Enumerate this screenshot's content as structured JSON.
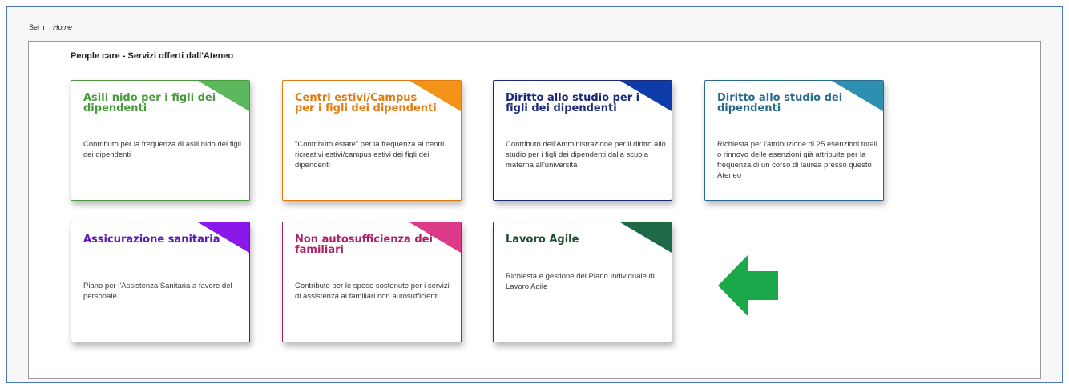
{
  "breadcrumb": {
    "prefix": "Sei in :",
    "current": "Home"
  },
  "panel": {
    "title": "People care - Servizi offerti dall'Ateneo"
  },
  "cards": [
    {
      "title": "Asili nido per i figli dei dipendenti",
      "description": "Contributo per la frequenza di asili nido dei figli dei dipendenti",
      "color": "#4a9a3d",
      "corner": "#5cb85c"
    },
    {
      "title": "Centri estivi/Campus per i figli dei dipendenti",
      "description": "\"Contributo estate\" per la frequenza ai centri ricreativi estivi/campus estivi dei figli dei dipendenti",
      "color": "#e07b12",
      "corner": "#f39419"
    },
    {
      "title": "Diritto allo studio per i figli dei dipendenti",
      "description": "Contributo dell'Amministrazione per il diritto allo studio per i figli dei dipendenti dalla scuola materna all'università",
      "color": "#1a2a78",
      "corner": "#0d3ca8"
    },
    {
      "title": "Diritto allo studio dei dipendenti",
      "description": "Richiesta per l'attribuzione di 25 esenzioni totali o rinnovo delle esenzioni già attribuite per la frequenza di un corso di laurea presso questo Ateneo",
      "color": "#2a6a8a",
      "corner": "#2e8fb0"
    },
    {
      "title": "Assicurazione sanitaria",
      "description": "Piano per l'Assistenza Sanitaria a favore del personale",
      "color": "#5a1ab0",
      "corner": "#8a18e8"
    },
    {
      "title": "Non autosufficienza dei familiari",
      "description": "Contributo per le spese sostenute per i servizi di assistenza ai familiari non autosufficienti",
      "color": "#b0206a",
      "corner": "#dd3a8a"
    },
    {
      "title": "Lavoro Agile",
      "description": "Richiesta e gestione del Piano Individuale di Lavoro Agile",
      "color": "#1d4a30",
      "corner": "#1e6a48"
    }
  ],
  "arrow": {
    "color": "#1aa84a"
  }
}
